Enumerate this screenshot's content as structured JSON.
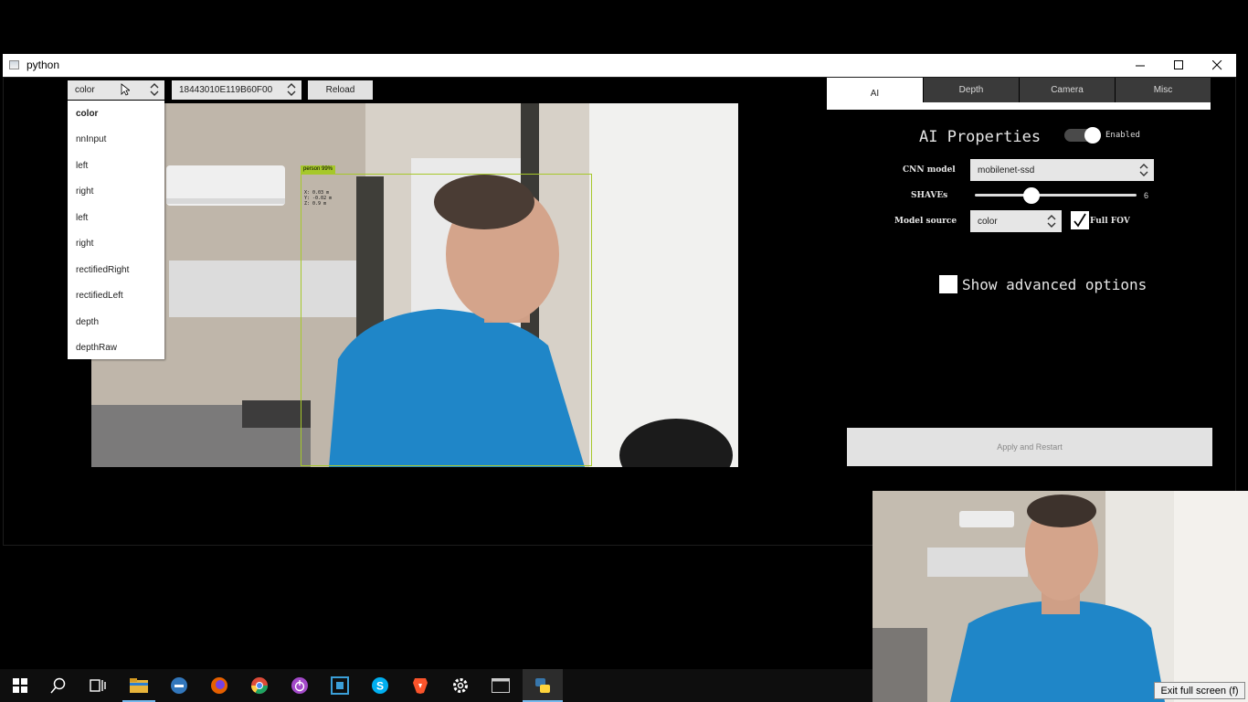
{
  "window": {
    "title": "python",
    "controls": [
      "─",
      "☐",
      "✕"
    ]
  },
  "toolbar": {
    "source_combo_value": "color",
    "device_combo_value": "18443010E119B60F00",
    "reload_label": "Reload"
  },
  "source_dropdown": {
    "items": [
      "color",
      "nnInput",
      "left",
      "right",
      "left",
      "right",
      "rectifiedRight",
      "rectifiedLeft",
      "depth",
      "depthRaw"
    ],
    "selected": "color"
  },
  "camera": {
    "detection_label": "person 99%",
    "detection_coords": [
      "X: 0.03 m",
      "Y: -0.02 m",
      "Z: 0.9 m"
    ]
  },
  "tabs": [
    "AI",
    "Depth",
    "Camera",
    "Misc"
  ],
  "active_tab": "AI",
  "ai_panel": {
    "title": "AI Properties",
    "enabled_label": "Enabled",
    "enabled": true,
    "cnn_model_label": "CNN model",
    "cnn_model_value": "mobilenet-ssd",
    "shaves_label": "SHAVEs",
    "shaves_value": "6",
    "model_source_label": "Model source",
    "model_source_value": "color",
    "full_fov_label": "Full FOV",
    "full_fov_checked": true,
    "advanced_label": "Show advanced options",
    "advanced_checked": false,
    "apply_label": "Apply and Restart"
  },
  "overlay": {
    "exit_fullscreen": "Exit full screen (f)"
  },
  "taskbar": {
    "icons": [
      "windows-start",
      "search",
      "task-view",
      "file-explorer",
      "edge-legacy",
      "firefox",
      "chrome",
      "tor-icon",
      "pycharm",
      "skype",
      "brave",
      "settings",
      "terminal",
      "python"
    ]
  },
  "colors": {
    "detection_box": "#a6c82a",
    "tab_inactive": "#3a3a3a",
    "taskbar_accent": "#76b9ed"
  }
}
